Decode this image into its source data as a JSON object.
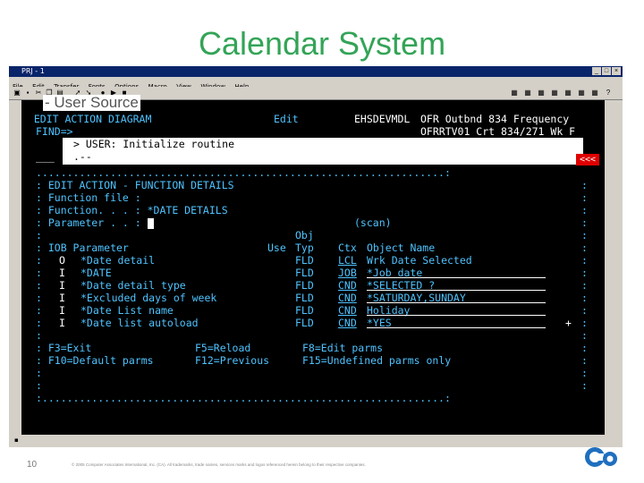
{
  "slide": {
    "title": "Calendar System",
    "overlay": "- User Source",
    "page_number": "10",
    "footer": "© 2005 Computer Associates International, Inc. (CA). All trademarks, trade names, services marks and logos referenced herein belong to their respective companies."
  },
  "window": {
    "title": "PRJ - 1"
  },
  "menu": [
    "File",
    "Edit",
    "Transfer",
    "Fonts",
    "Options",
    "Macro",
    "View",
    "Window",
    "Help"
  ],
  "terminal": {
    "header_left": "EDIT ACTION DIAGRAM",
    "header_mode": "Edit",
    "header_lib": "EHSDEVMDL",
    "header_right1": "OFR Outbnd 834 Frequency",
    "find_label": "FIND=>",
    "header_right2": "OFRRTV01 Crt 834/271 Wk F",
    "user_line": "> USER: Initialize routine",
    "user_line2": ".--",
    "blank_line": "___",
    "red_marker": "<<<",
    "dots_top": "..................................................................:",
    "details_title": ": EDIT ACTION - FUNCTION DETAILS",
    "fn_file": ": Function file :",
    "fn": ": Function. . . : *DATE DETAILS",
    "param": ": Parameter . . :",
    "scan": "(scan)",
    "obj": "Obj",
    "col_header": ": IOB Parameter",
    "col_use": "Use",
    "col_typ": "Typ",
    "col_ctx": "Ctx",
    "col_obj": "Object Name",
    "rows": [
      {
        "iob": "O",
        "param": "*Date detail",
        "typ": "FLD",
        "ctx": "LCL",
        "obj": "Wrk Date Selected"
      },
      {
        "iob": "I",
        "param": "*DATE",
        "typ": "FLD",
        "ctx": "JOB",
        "obj": "*Job date"
      },
      {
        "iob": "I",
        "param": "*Date detail type",
        "typ": "FLD",
        "ctx": "CND",
        "obj": "*SELECTED ?"
      },
      {
        "iob": "I",
        "param": "*Excluded days of week",
        "typ": "FLD",
        "ctx": "CND",
        "obj": "*SATURDAY,SUNDAY"
      },
      {
        "iob": "I",
        "param": "*Date List name",
        "typ": "FLD",
        "ctx": "CND",
        "obj": "Holiday"
      },
      {
        "iob": "I",
        "param": "*Date list autoload",
        "typ": "FLD",
        "ctx": "CND",
        "obj": "*YES"
      }
    ],
    "plus": "+",
    "f3": ": F3=Exit",
    "f5": "F5=Reload",
    "f8": "F8=Edit parms",
    "f10": ": F10=Default parms",
    "f12": "F12=Previous",
    "f15": "F15=Undefined parms only",
    "dots_bottom": ":.................................................................:"
  },
  "colors": {
    "title": "#33a457",
    "terminal_bg": "#000000",
    "cyan": "#4ec3ff",
    "green": "#3adf3a",
    "red": "#e00000"
  }
}
